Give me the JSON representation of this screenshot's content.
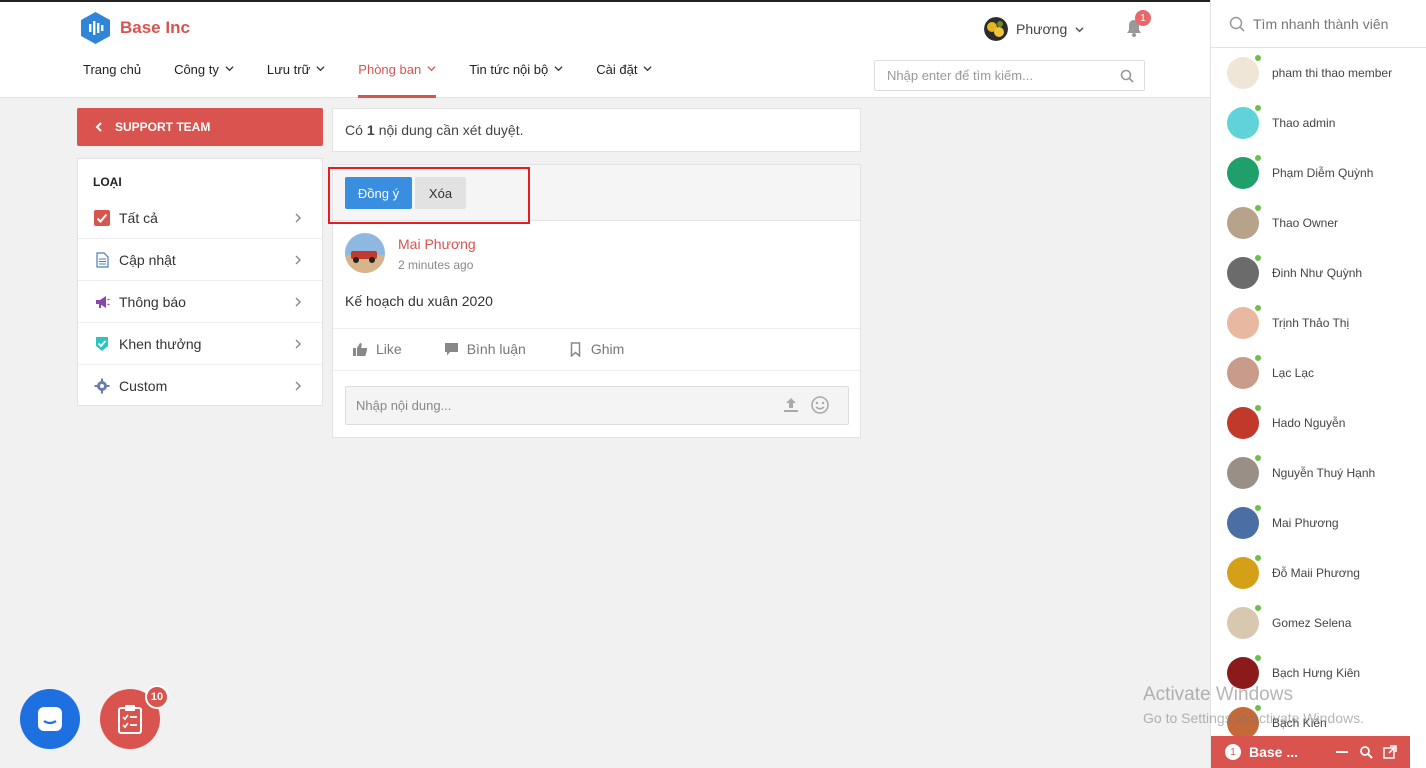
{
  "header": {
    "brand": "Base Inc",
    "nav": [
      {
        "label": "Trang chủ",
        "dropdown": false,
        "active": false
      },
      {
        "label": "Công ty",
        "dropdown": true,
        "active": false
      },
      {
        "label": "Lưu trữ",
        "dropdown": true,
        "active": false
      },
      {
        "label": "Phòng ban",
        "dropdown": true,
        "active": true
      },
      {
        "label": "Tin tức nội bộ",
        "dropdown": true,
        "active": false
      },
      {
        "label": "Cài đặt",
        "dropdown": true,
        "active": false
      }
    ],
    "user_name": "Phương",
    "notification_count": "1",
    "search_placeholder": "Nhập enter để tìm kiếm..."
  },
  "left": {
    "team_label": "SUPPORT TEAM",
    "category_title": "LOẠI",
    "categories": [
      {
        "label": "Tất cả",
        "icon": "checkbox-icon"
      },
      {
        "label": "Cập nhật",
        "icon": "document-icon"
      },
      {
        "label": "Thông báo",
        "icon": "megaphone-icon"
      },
      {
        "label": "Khen thưởng",
        "icon": "badge-icon"
      },
      {
        "label": "Custom",
        "icon": "gear-icon"
      }
    ]
  },
  "notice": {
    "prefix": "Có",
    "count": "1",
    "suffix": "nội dung cần xét duyệt."
  },
  "post": {
    "approve_label": "Đồng ý",
    "delete_label": "Xóa",
    "author": "Mai Phương",
    "time": "2 minutes ago",
    "body": "Kế hoạch du xuân 2020",
    "like_label": "Like",
    "comment_label": "Bình luận",
    "pin_label": "Ghim",
    "comment_placeholder": "Nhập nội dung..."
  },
  "sidebar": {
    "search_placeholder": "Tìm nhanh thành viên",
    "members": [
      {
        "name": "pham thi thao member",
        "color": "#efe6d8"
      },
      {
        "name": "Thao admin",
        "color": "#5fd3d8"
      },
      {
        "name": "Phạm Diễm Quỳnh",
        "color": "#1fa06a"
      },
      {
        "name": "Thao Owner",
        "color": "#b7a38a"
      },
      {
        "name": "Đinh Như Quỳnh",
        "color": "#6b6b6b"
      },
      {
        "name": "Trịnh Thảo Thị",
        "color": "#e8b8a0"
      },
      {
        "name": "Lạc Lạc",
        "color": "#c99b8a"
      },
      {
        "name": "Hado Nguyễn",
        "color": "#c0392b"
      },
      {
        "name": "Nguyễn Thuý Hạnh",
        "color": "#9a8f86"
      },
      {
        "name": "Mai Phương",
        "color": "#4a6fa5"
      },
      {
        "name": "Đỗ Maii Phương",
        "color": "#d4a017"
      },
      {
        "name": "Gomez Selena",
        "color": "#d8c8b0"
      },
      {
        "name": "Bạch Hưng Kiên",
        "color": "#8b1a1a"
      },
      {
        "name": "Bạch Kiên",
        "color": "#c46a3a"
      }
    ],
    "chat_title": "Base ...",
    "chat_count": "1"
  },
  "watermark": {
    "line1": "Activate Windows",
    "line2": "Go to Settings to activate Windows."
  },
  "fab": {
    "task_count": "10"
  },
  "colors": {
    "accent": "#d9534f",
    "primary": "#3a8ee0",
    "online": "#6cc04a"
  }
}
